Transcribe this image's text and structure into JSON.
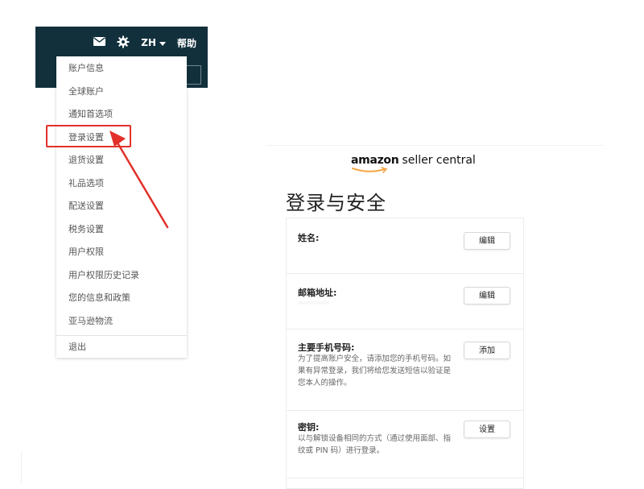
{
  "header": {
    "lang": "ZH",
    "help": "帮助",
    "icons": [
      "mail-icon",
      "gear-icon",
      "chevron-down-icon"
    ],
    "bg_color": "#12303c"
  },
  "dropdown": {
    "items": [
      "账户信息",
      "全球账户",
      "通知首选项",
      "登录设置",
      "退货设置",
      "礼品选项",
      "配送设置",
      "税务设置",
      "用户权限",
      "用户权限历史记录",
      "您的信息和政策",
      "亚马逊物流"
    ],
    "logout": "退出",
    "highlighted": "登录设置",
    "highlight_color": "#e2302a"
  },
  "brand": {
    "amazon": "amazon",
    "suffix": "seller central"
  },
  "page": {
    "title": "登录与安全"
  },
  "settings": {
    "name": {
      "label": "姓名:",
      "button": "编辑"
    },
    "email": {
      "label": "邮箱地址:",
      "button": "编辑",
      "value_blurred": "··············"
    },
    "phone": {
      "label": "主要手机号码:",
      "desc": "为了提高账户安全，请添加您的手机号码。如果有异常登录，我们将给您发送短信以验证是您本人的操作。",
      "button": "添加"
    },
    "passkey": {
      "label": "密钥:",
      "desc": "以与解锁设备相同的方式（通过使用面部、指纹或 PIN 码）进行登录。",
      "button": "设置"
    }
  }
}
